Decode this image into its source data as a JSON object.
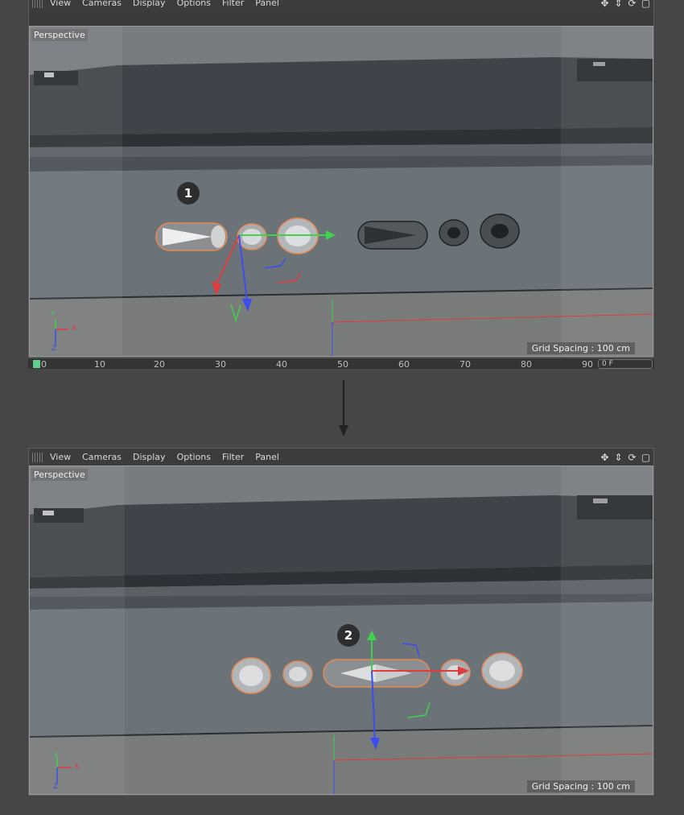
{
  "menu": {
    "items": [
      "View",
      "Cameras",
      "Display",
      "Options",
      "Filter",
      "Panel"
    ]
  },
  "viewport": {
    "label": "Perspective",
    "grid_spacing": "Grid Spacing : 100 cm"
  },
  "axis_labels": {
    "y": "Y",
    "x": "X",
    "z": "Z"
  },
  "steps": [
    "1",
    "2"
  ],
  "timeline": {
    "ticks": [
      "0",
      "10",
      "20",
      "30",
      "40",
      "50",
      "60",
      "70",
      "80",
      "90"
    ],
    "current_frame_field": "0 F"
  },
  "colors": {
    "background": "#464646",
    "axis_x": "#e03c3c",
    "axis_y": "#3fd24a",
    "axis_z": "#3b4ef0",
    "selection": "#e58a55",
    "frame_marker": "#5fd08c"
  },
  "icons": {
    "menu_grip": "grip-icon",
    "nav": [
      "move-view-icon",
      "zoom-view-icon",
      "rotate-view-icon",
      "maximize-view-icon"
    ]
  }
}
